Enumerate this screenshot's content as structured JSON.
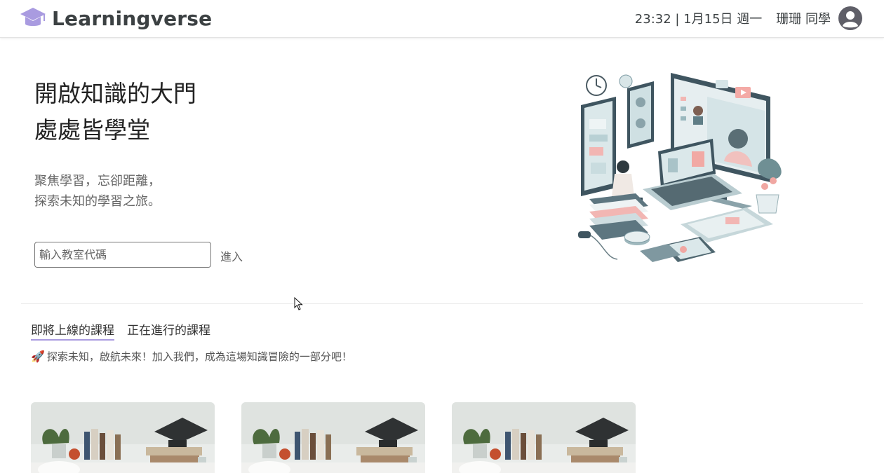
{
  "header": {
    "app_name": "Learningverse",
    "datetime": "23:32 | 1月15日 週一",
    "user_name": "珊珊 同學",
    "logo_icon": "graduation-cap-icon",
    "avatar_icon": "user-avatar-icon",
    "brand_color": "#a99be0"
  },
  "hero": {
    "title_line1": "開啟知識的大門",
    "title_line2": "處處皆學堂",
    "subtitle_line1": "聚焦學習，忘卻距離，",
    "subtitle_line2": "探索未知的學習之旅。",
    "code_input": {
      "value": "",
      "placeholder": "輸入教室代碼"
    },
    "enter_label": "進入"
  },
  "courses": {
    "tabs": [
      {
        "label": "即將上線的課程",
        "active": true
      },
      {
        "label": "正在進行的課程",
        "active": false
      }
    ],
    "tagline_icon": "rocket-icon",
    "tagline": "探索未知，啟航未來！加入我們，成為這場知識冒險的一部分吧！",
    "cards": [
      {
        "image": "graduation-desk-image"
      },
      {
        "image": "graduation-desk-image"
      },
      {
        "image": "graduation-desk-image"
      }
    ]
  }
}
